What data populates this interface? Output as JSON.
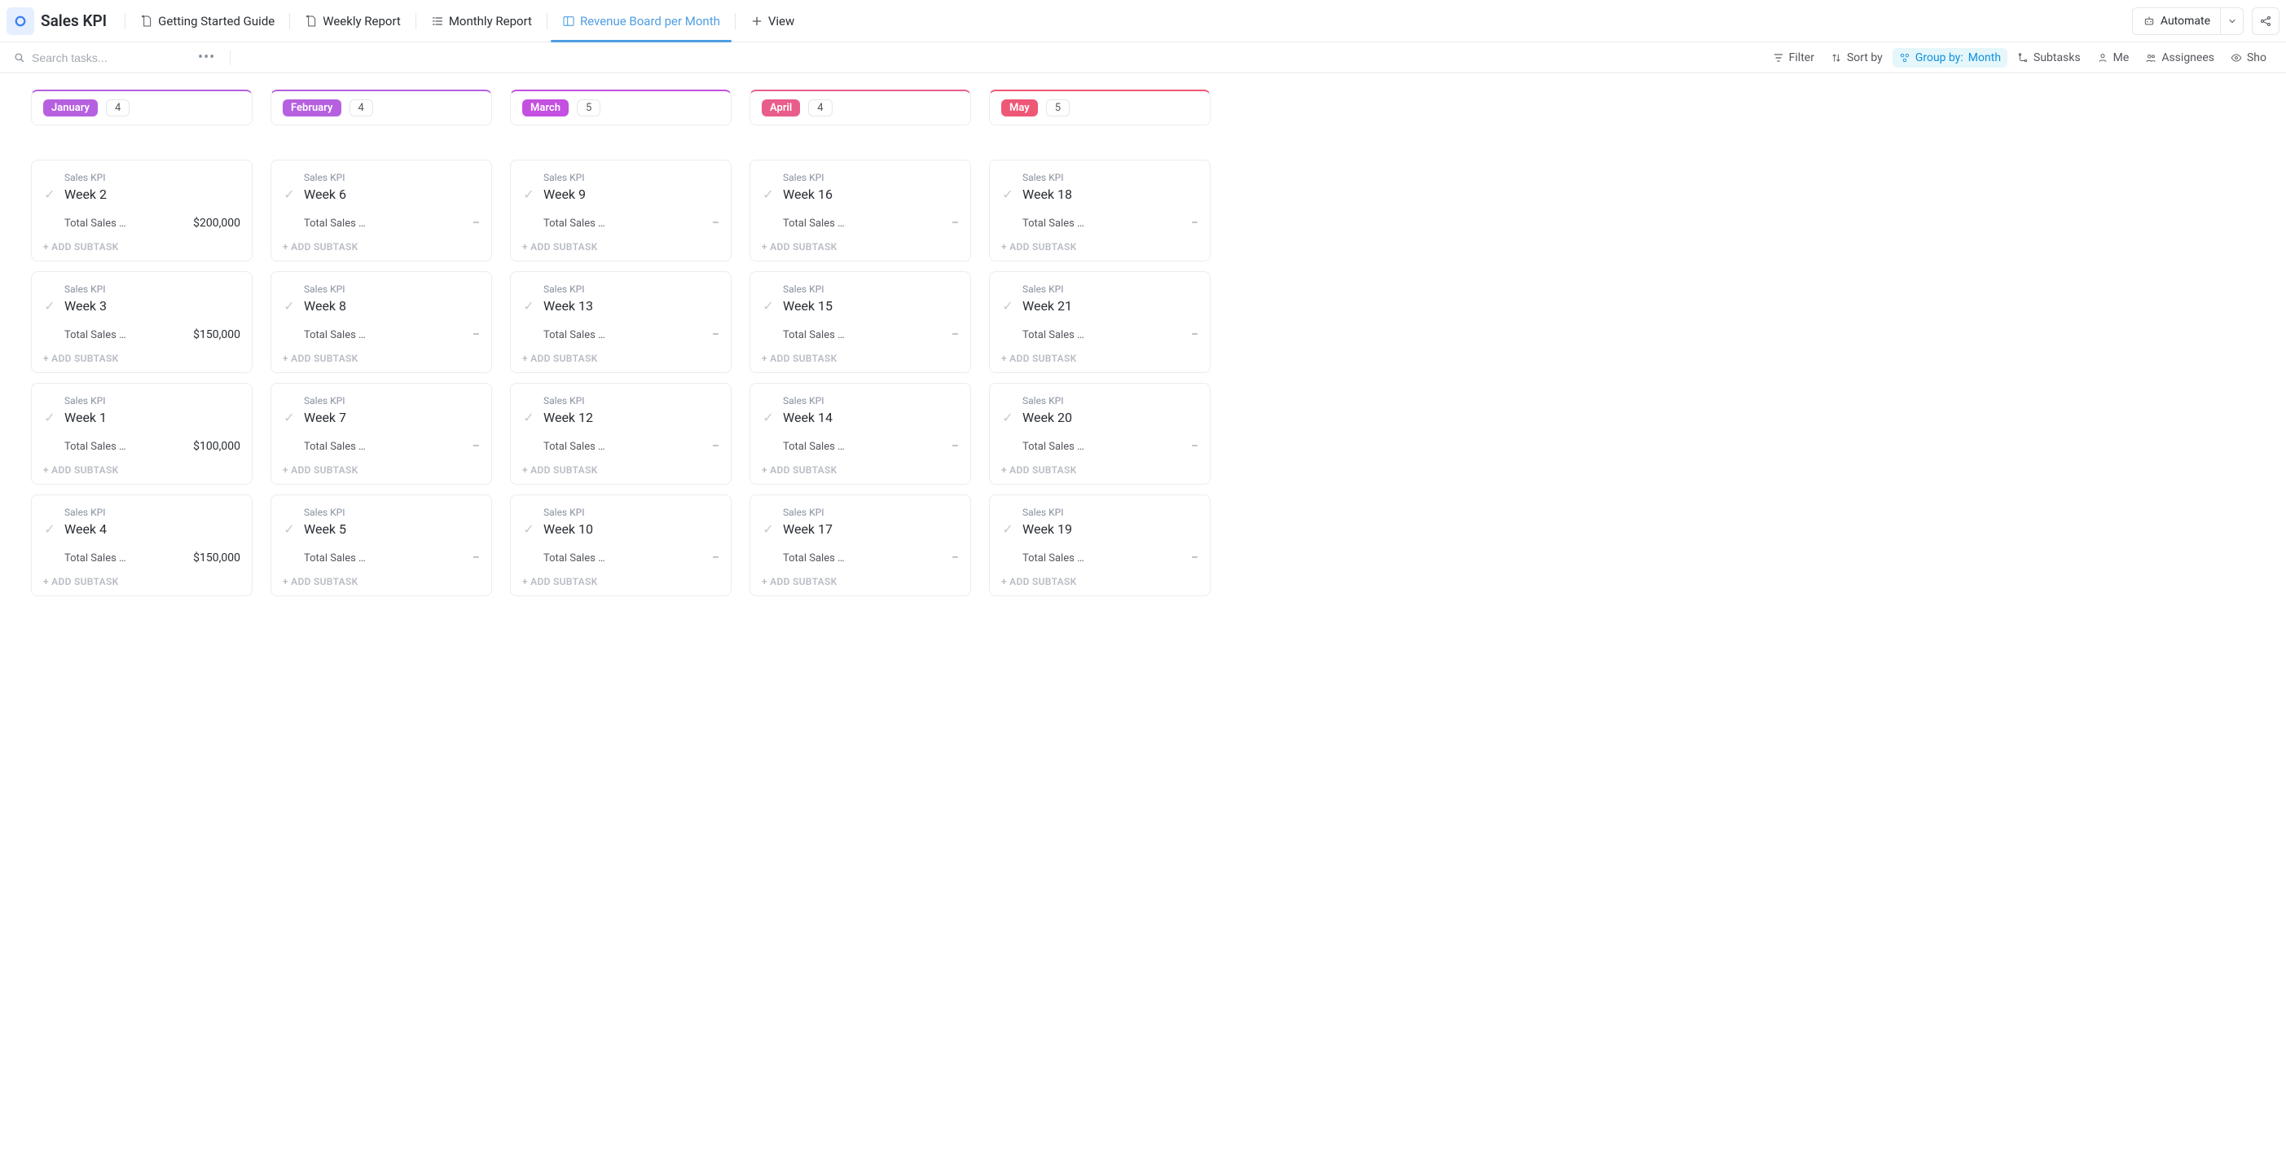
{
  "header": {
    "title": "Sales KPI",
    "tabs": [
      {
        "label": "Getting Started Guide"
      },
      {
        "label": "Weekly Report"
      },
      {
        "label": "Monthly Report"
      },
      {
        "label": "Revenue Board per Month"
      },
      {
        "label": "View"
      }
    ],
    "automate": "Automate"
  },
  "toolbar": {
    "search_placeholder": "Search tasks...",
    "filter": "Filter",
    "sort": "Sort by",
    "group_label": "Group by:",
    "group_value": "Month",
    "subtasks": "Subtasks",
    "me": "Me",
    "assignees": "Assignees",
    "show": "Sho"
  },
  "common": {
    "project": "Sales KPI",
    "metric_label": "Total Sales …",
    "add_subtask": "+ ADD SUBTASK"
  },
  "board": [
    {
      "month": "January",
      "color": "#b660e0",
      "count": "4",
      "cards": [
        {
          "title": "Week 2",
          "value": "$200,000"
        },
        {
          "title": "Week 3",
          "value": "$150,000"
        },
        {
          "title": "Week 1",
          "value": "$100,000"
        },
        {
          "title": "Week 4",
          "value": "$150,000"
        }
      ]
    },
    {
      "month": "February",
      "color": "#b660e0",
      "count": "4",
      "cards": [
        {
          "title": "Week 6",
          "value": "–"
        },
        {
          "title": "Week 8",
          "value": "–"
        },
        {
          "title": "Week 7",
          "value": "–"
        },
        {
          "title": "Week 5",
          "value": "–"
        }
      ]
    },
    {
      "month": "March",
      "color": "#c44fe0",
      "count": "5",
      "cards": [
        {
          "title": "Week 9",
          "value": "–"
        },
        {
          "title": "Week 13",
          "value": "–"
        },
        {
          "title": "Week 12",
          "value": "–"
        },
        {
          "title": "Week 10",
          "value": "–"
        }
      ]
    },
    {
      "month": "April",
      "color": "#e85d8a",
      "count": "4",
      "cards": [
        {
          "title": "Week 16",
          "value": "–"
        },
        {
          "title": "Week 15",
          "value": "–"
        },
        {
          "title": "Week 14",
          "value": "–"
        },
        {
          "title": "Week 17",
          "value": "–"
        }
      ]
    },
    {
      "month": "May",
      "color": "#ef5777",
      "count": "5",
      "cards": [
        {
          "title": "Week 18",
          "value": "–"
        },
        {
          "title": "Week 21",
          "value": "–"
        },
        {
          "title": "Week 20",
          "value": "–"
        },
        {
          "title": "Week 19",
          "value": "–"
        }
      ]
    }
  ]
}
